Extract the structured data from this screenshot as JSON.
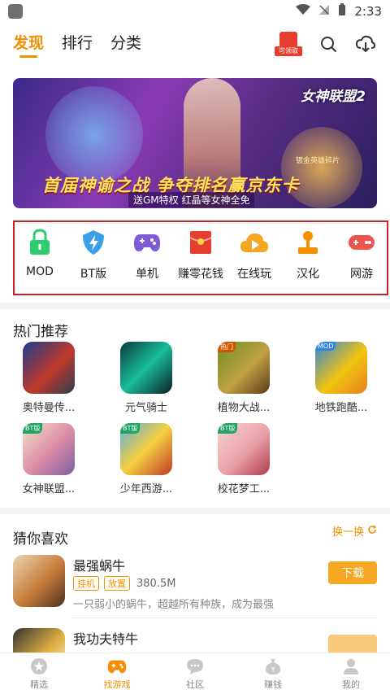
{
  "status": {
    "time": "2:33"
  },
  "header": {
    "tabs": [
      {
        "label": "发现",
        "active": true
      },
      {
        "label": "排行",
        "active": false
      },
      {
        "label": "分类",
        "active": false
      }
    ],
    "gift_label": "可领取"
  },
  "banner": {
    "logo_text": "女神联盟2",
    "sub_text": "镀金英雄碎片",
    "headline": "首届神谕之战 争夺排名赢京东卡",
    "tagline": "送GM特权 红晶等女神全免"
  },
  "categories": [
    {
      "label": "MOD",
      "icon": "lock-icon",
      "color": "#2ecc71"
    },
    {
      "label": "BT版",
      "icon": "shield-icon",
      "color": "#3a9ee8"
    },
    {
      "label": "单机",
      "icon": "gamepad-icon",
      "color": "#7d5cd6"
    },
    {
      "label": "赚零花钱",
      "icon": "red-envelope-icon",
      "color": "#e63d2f"
    },
    {
      "label": "在线玩",
      "icon": "cloud-play-icon",
      "color": "#f5a623"
    },
    {
      "label": "汉化",
      "icon": "joystick-icon",
      "color": "#f39000"
    },
    {
      "label": "网游",
      "icon": "controller-icon",
      "color": "#ef5350"
    }
  ],
  "hot": {
    "title": "热门推荐",
    "games": [
      {
        "name": "奥特曼传...",
        "badge": ""
      },
      {
        "name": "元气骑士",
        "badge": ""
      },
      {
        "name": "植物大战...",
        "badge": "热门"
      },
      {
        "name": "地铁跑酷...",
        "badge": "MOD"
      },
      {
        "name": "女神联盟...",
        "badge": "BT版"
      },
      {
        "name": "少年西游...",
        "badge": "BT版"
      },
      {
        "name": "校花梦工...",
        "badge": "BT版"
      }
    ]
  },
  "guess": {
    "title": "猜你喜欢",
    "refresh_label": "换一换",
    "items": [
      {
        "title": "最强蜗牛",
        "tags": [
          "挂机",
          "放置"
        ],
        "size": "380.5M",
        "desc": "一只弱小的蜗牛，超越所有种族，成为最强",
        "button": "下载"
      },
      {
        "title": "我功夫特牛",
        "tags": [],
        "size": "",
        "desc": "",
        "button": ""
      }
    ]
  },
  "bottom_nav": [
    {
      "label": "精选",
      "icon": "star-icon",
      "active": false
    },
    {
      "label": "找游戏",
      "icon": "gamepad-icon",
      "active": true
    },
    {
      "label": "社区",
      "icon": "chat-icon",
      "active": false
    },
    {
      "label": "赚钱",
      "icon": "money-bag-icon",
      "active": false
    },
    {
      "label": "我的",
      "icon": "user-icon",
      "active": false
    }
  ],
  "colors": {
    "accent": "#f39000",
    "highlight_frame": "#d01f2a"
  }
}
